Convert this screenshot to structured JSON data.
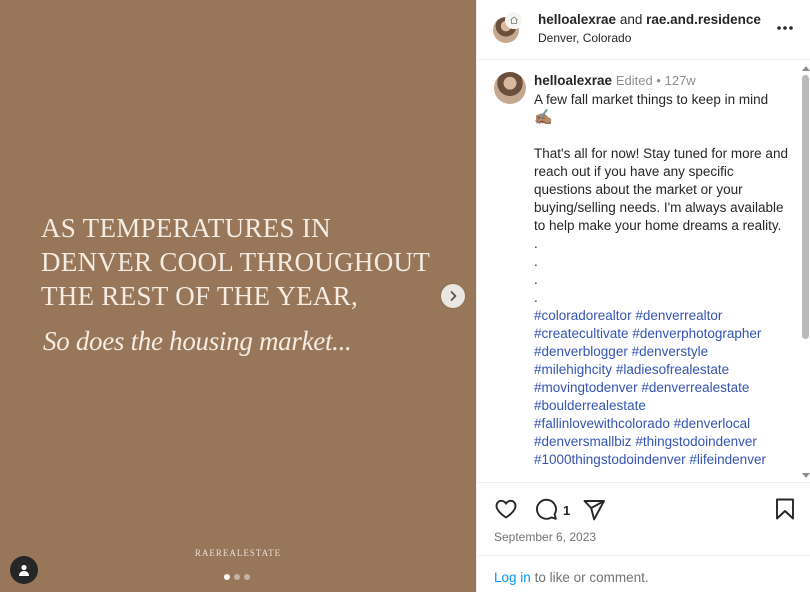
{
  "media": {
    "headline": "AS TEMPERATURES IN\nDENVER COOL THROUGHOUT\nTHE REST OF THE YEAR,",
    "subline": "So does the housing market...",
    "brand_mark": "RAEREALESTATE",
    "background_color": "#98765a",
    "slide_count": 3,
    "current_slide": 1,
    "next_icon": "chevron-right-icon",
    "tag_icon": "person-icon"
  },
  "header": {
    "author": "helloalexrae",
    "connector": "and",
    "collaborator": "rae.and.residence",
    "location": "Denver, Colorado",
    "more_icon": "more-horizontal-icon"
  },
  "caption": {
    "username": "helloalexrae",
    "meta": "Edited •",
    "age": "127w",
    "intro": "A few fall market things to keep in mind",
    "emoji": "✍🏽",
    "body": "That's all for now! Stay tuned for more and reach out if you have any specific questions about the market or your buying/selling needs. I'm always available to help make your home dreams a reality.",
    "dots": [
      ".",
      ".",
      ".",
      "."
    ],
    "hashtags": [
      [
        "#coloradorealtor",
        "#denverrealtor"
      ],
      [
        "#createcultivate",
        "#denverphotographer"
      ],
      [
        "#denverblogger",
        "#denverstyle"
      ],
      [
        "#milehighcity",
        "#ladiesofrealestate"
      ],
      [
        "#movingtodenver",
        "#denverrealestate"
      ],
      [
        "#boulderrealestate"
      ],
      [
        "#fallinlovewithcolorado",
        "#denverlocal"
      ],
      [
        "#denversmallbiz",
        "#thingstodoindenver"
      ],
      [
        "#1000thingstodoindenver",
        "#lifeindenver"
      ]
    ]
  },
  "actions": {
    "like_icon": "heart-icon",
    "comment_icon": "comment-icon",
    "comment_count": "1",
    "share_icon": "paper-plane-icon",
    "save_icon": "bookmark-icon",
    "date": "September 6, 2023"
  },
  "login": {
    "link": "Log in",
    "text": "to like or comment."
  },
  "colors": {
    "link": "#0095f6",
    "hashtag": "#3454b4",
    "muted": "#737373"
  }
}
